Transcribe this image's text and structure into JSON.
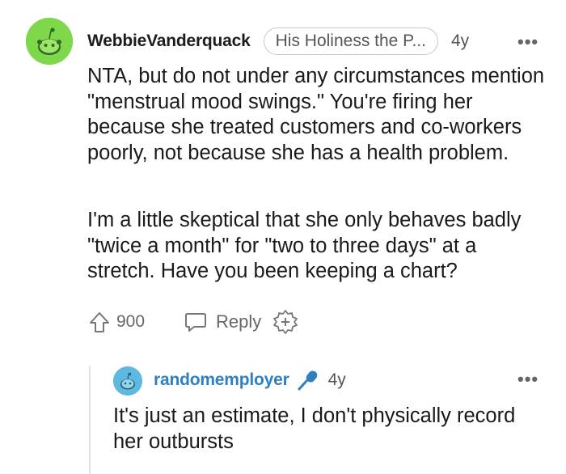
{
  "comment": {
    "username": "WebbieVanderquack",
    "flair": "His Holiness the P...",
    "age": "4y",
    "more_glyph": "•••",
    "paragraphs": [
      "NTA, but do not under any circumstances mention \"menstrual mood swings.\" You're firing her because she treated customers and co-workers poorly, not because she has a health problem.",
      "I'm a little skeptical that she only behaves badly \"twice a month\" for \"two to three days\" at a stretch. Have you been keeping a chart?"
    ],
    "votes": "900",
    "reply_label": "Reply",
    "avatar_color": "#7fd84a"
  },
  "reply": {
    "username": "randomemployer",
    "age": "4y",
    "more_glyph": "•••",
    "text": "It's just an estimate, I don't physically record her outbursts",
    "avatar_color": "#5fb8e0",
    "username_color": "#2f7fc1",
    "mic_color": "#2f7fc1"
  },
  "icons": {
    "upvote": "upvote-arrow-icon",
    "reply": "speech-bubble-icon",
    "award": "award-plus-icon",
    "mic": "microphone-icon",
    "avatar": "snoo-avatar-icon"
  }
}
